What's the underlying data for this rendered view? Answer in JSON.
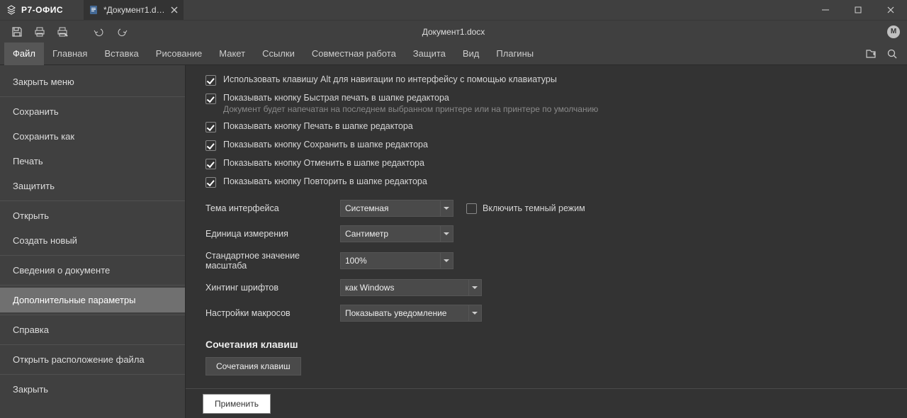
{
  "titlebar": {
    "app_name": "Р7-ОФИС",
    "tab_label": "*Документ1.d…"
  },
  "quickbar": {
    "doc_title": "Документ1.docx",
    "avatar_initial": "М"
  },
  "menubar": {
    "items": [
      "Файл",
      "Главная",
      "Вставка",
      "Рисование",
      "Макет",
      "Ссылки",
      "Совместная работа",
      "Защита",
      "Вид",
      "Плагины"
    ]
  },
  "sidebar": {
    "items": [
      {
        "label": "Закрыть меню"
      },
      {
        "sep": true
      },
      {
        "label": "Сохранить"
      },
      {
        "label": "Сохранить как"
      },
      {
        "label": "Печать"
      },
      {
        "label": "Защитить"
      },
      {
        "sep": true
      },
      {
        "label": "Открыть"
      },
      {
        "label": "Создать новый"
      },
      {
        "sep": true
      },
      {
        "label": "Сведения о документе"
      },
      {
        "sep": true
      },
      {
        "label": "Дополнительные параметры",
        "selected": true
      },
      {
        "sep": true
      },
      {
        "label": "Справка"
      },
      {
        "sep": true
      },
      {
        "label": "Открыть расположение файла"
      },
      {
        "sep": true
      },
      {
        "label": "Закрыть"
      }
    ]
  },
  "settings": {
    "checks": [
      {
        "label": "Использовать клавишу Alt для навигации по интерфейсу с помощью клавиатуры",
        "checked": true
      },
      {
        "label": "Показывать кнопку Быстрая печать в шапке редактора",
        "checked": true,
        "desc": "Документ будет напечатан на последнем выбранном принтере или на принтере по умолчанию"
      },
      {
        "label": "Показывать кнопку Печать в шапке редактора",
        "checked": true
      },
      {
        "label": "Показывать кнопку Сохранить в шапке редактора",
        "checked": true
      },
      {
        "label": "Показывать кнопку Отменить в шапке редактора",
        "checked": true
      },
      {
        "label": "Показывать кнопку Повторить в шапке редактора",
        "checked": true
      }
    ],
    "rows": [
      {
        "label": "Тема интерфейса",
        "value": "Системная",
        "extra_chk": "Включить темный режим"
      },
      {
        "label": "Единица измерения",
        "value": "Сантиметр"
      },
      {
        "label": "Стандартное значение масштаба",
        "value": "100%"
      },
      {
        "label": "Хинтинг шрифтов",
        "value": "как Windows",
        "wide": true
      },
      {
        "label": "Настройки макросов",
        "value": "Показывать уведомление",
        "wide": true
      }
    ],
    "shortcuts_title": "Сочетания клавиш",
    "shortcuts_btn": "Сочетания клавиш",
    "apply": "Применить"
  }
}
